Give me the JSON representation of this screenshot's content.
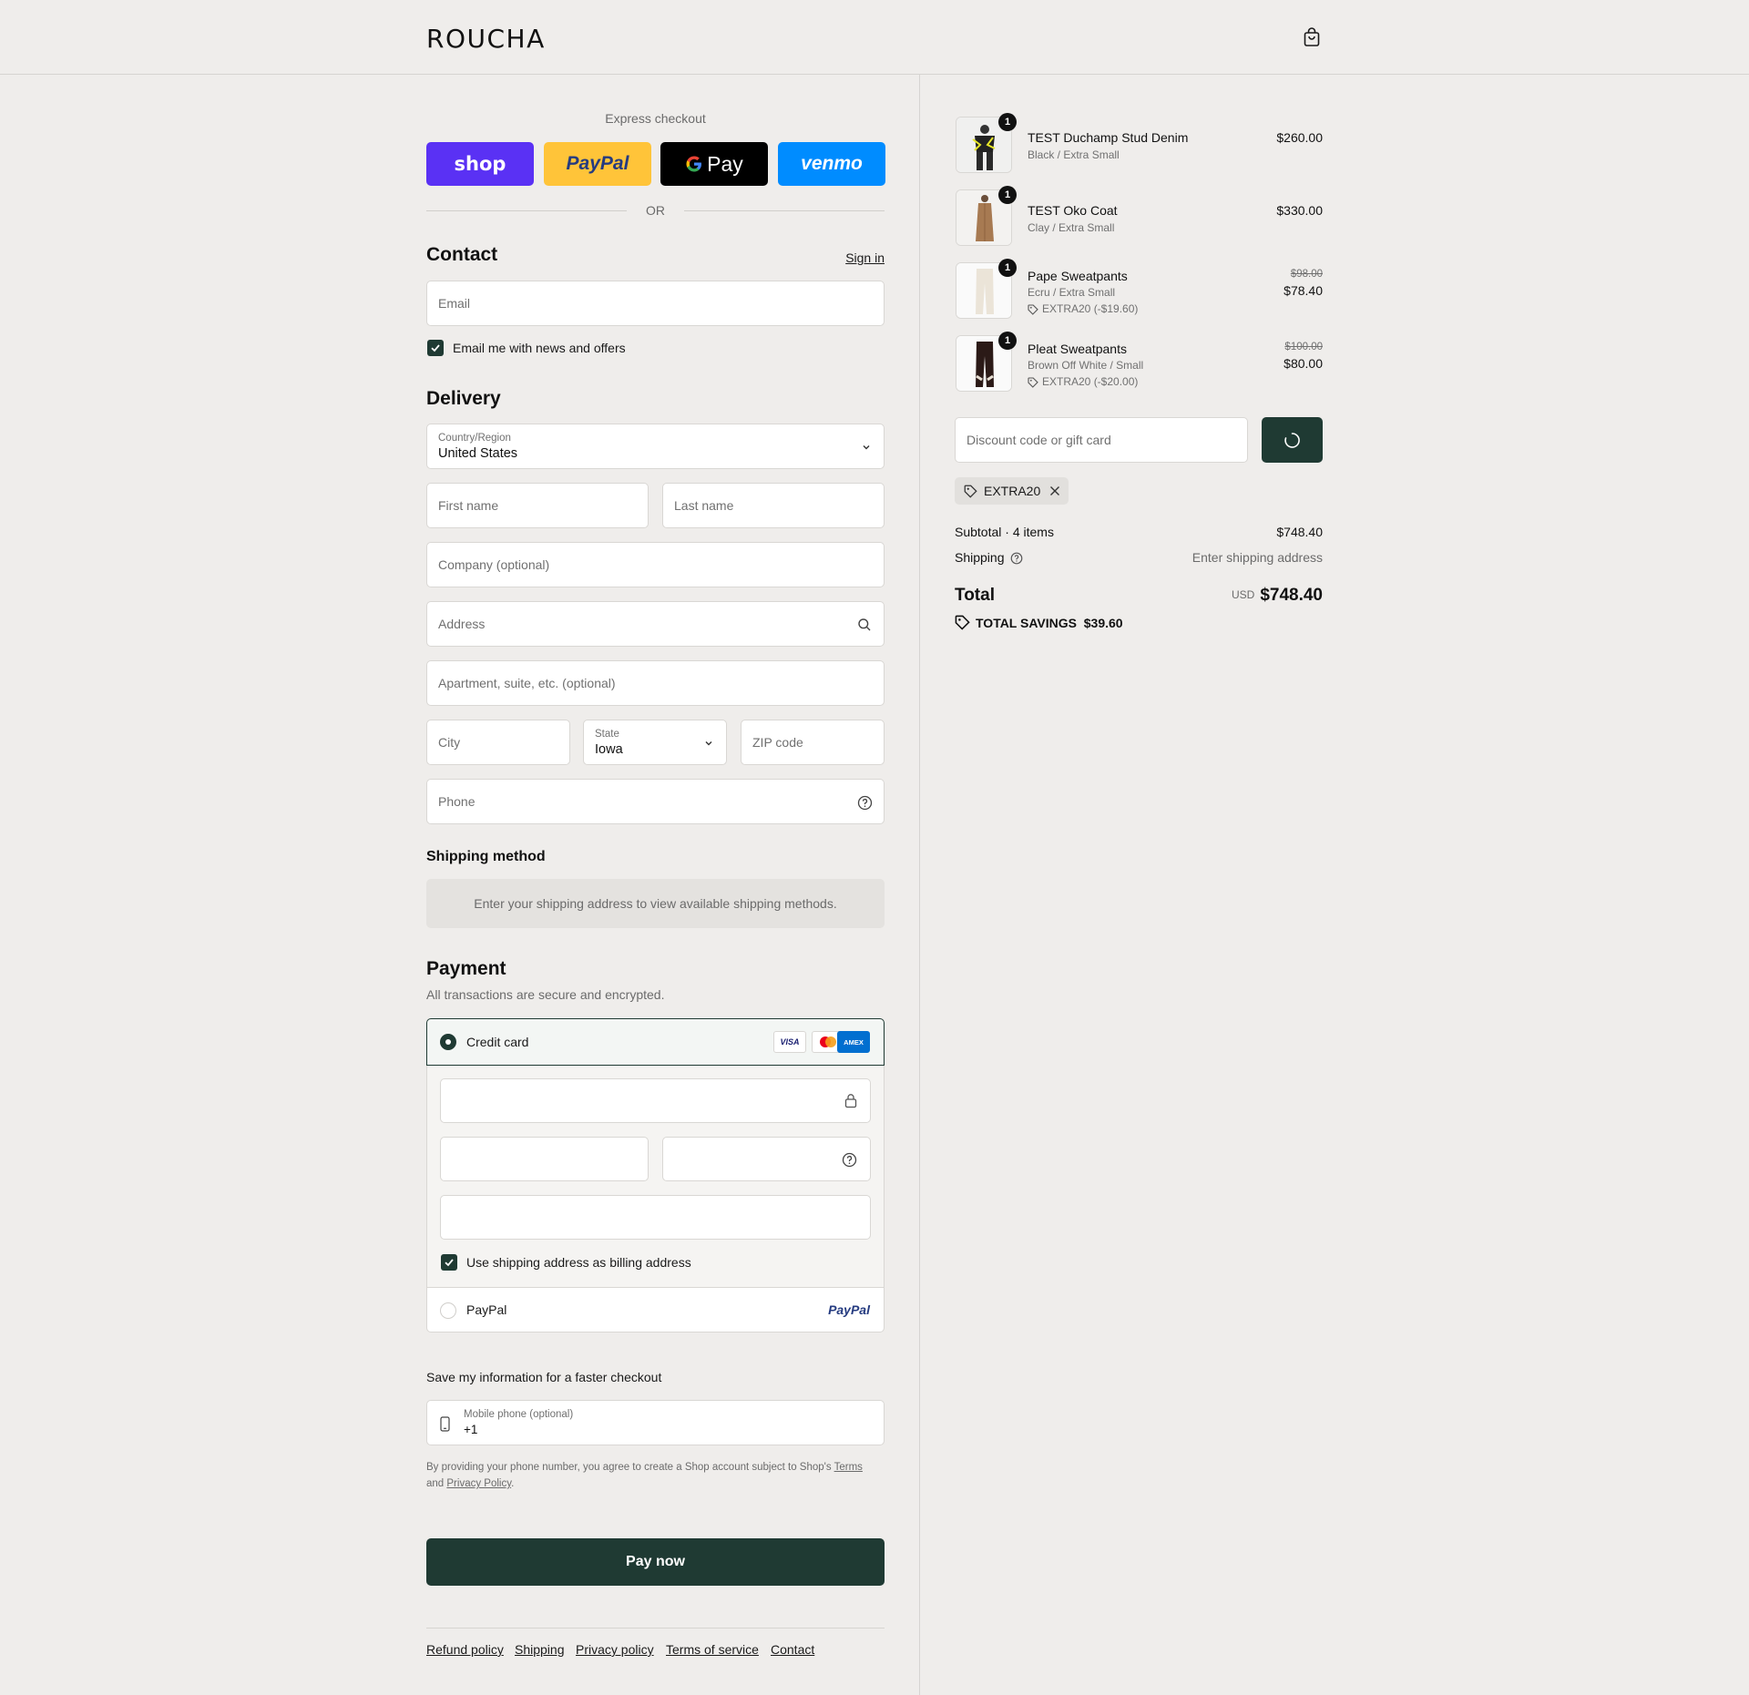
{
  "header": {
    "brand": "ROUCHA"
  },
  "express": {
    "title": "Express checkout",
    "buttons": [
      {
        "label": "shop",
        "bg": "#5a31f4",
        "fg": "#ffffff"
      },
      {
        "label": "PayPal",
        "bg": "#ffc439",
        "fg": "#253b80"
      },
      {
        "label": "Pay",
        "bg": "#000000",
        "fg": "#ffffff"
      },
      {
        "label": "venmo",
        "bg": "#008cff",
        "fg": "#ffffff"
      }
    ],
    "or": "OR"
  },
  "contact": {
    "title": "Contact",
    "sign_in": "Sign in",
    "email_placeholder": "Email",
    "newsletter_label": "Email me with news and offers",
    "newsletter_checked": true
  },
  "delivery": {
    "title": "Delivery",
    "country_label": "Country/Region",
    "country_value": "United States",
    "first_name": "First name",
    "last_name": "Last name",
    "company": "Company (optional)",
    "address": "Address",
    "apartment": "Apartment, suite, etc. (optional)",
    "city": "City",
    "state_label": "State",
    "state_value": "Iowa",
    "zip": "ZIP code",
    "phone": "Phone"
  },
  "shipping_method": {
    "title": "Shipping method",
    "message": "Enter your shipping address to view available shipping methods."
  },
  "payment": {
    "title": "Payment",
    "subtitle": "All transactions are secure and encrypted.",
    "credit_card_label": "Credit card",
    "card_brands": [
      "VISA",
      "Mastercard",
      "AMEX"
    ],
    "billing_label": "Use shipping address as billing address",
    "billing_checked": true,
    "paypal_label": "PayPal",
    "paypal_logo": "PayPal"
  },
  "save_info": {
    "title": "Save my information for a faster checkout",
    "phone_label": "Mobile phone (optional)",
    "phone_value": "+1",
    "legal_1": "By providing your phone number, you agree to create a Shop account subject to Shop's ",
    "terms": "Terms",
    "legal_2": "and ",
    "privacy": "Privacy Policy",
    "legal_end": "."
  },
  "pay_now": "Pay now",
  "footer_links": [
    "Refund policy",
    "Shipping",
    "Privacy policy",
    "Terms of service",
    "Contact"
  ],
  "cart": {
    "items": [
      {
        "name": "TEST Duchamp Stud Denim",
        "variant": "Black / Extra Small",
        "qty": "1",
        "price": "$260.00",
        "original": "",
        "discount": ""
      },
      {
        "name": "TEST Oko Coat",
        "variant": "Clay / Extra Small",
        "qty": "1",
        "price": "$330.00",
        "original": "",
        "discount": ""
      },
      {
        "name": "Pape Sweatpants",
        "variant": "Ecru / Extra Small",
        "qty": "1",
        "price": "$78.40",
        "original": "$98.00",
        "discount": "EXTRA20 (-$19.60)"
      },
      {
        "name": "Pleat Sweatpants",
        "variant": "Brown Off White / Small",
        "qty": "1",
        "price": "$80.00",
        "original": "$100.00",
        "discount": "EXTRA20 (-$20.00)"
      }
    ],
    "discount_placeholder": "Discount code or gift card",
    "applied_code": "EXTRA20",
    "subtotal_label": "Subtotal · 4 items",
    "subtotal_value": "$748.40",
    "shipping_label": "Shipping",
    "shipping_value": "Enter shipping address",
    "total_label": "Total",
    "currency": "USD",
    "total_value": "$748.40",
    "savings_label": "TOTAL SAVINGS",
    "savings_value": "$39.60"
  },
  "colors": {
    "accent": "#1f3a33",
    "background": "#efedeb"
  }
}
